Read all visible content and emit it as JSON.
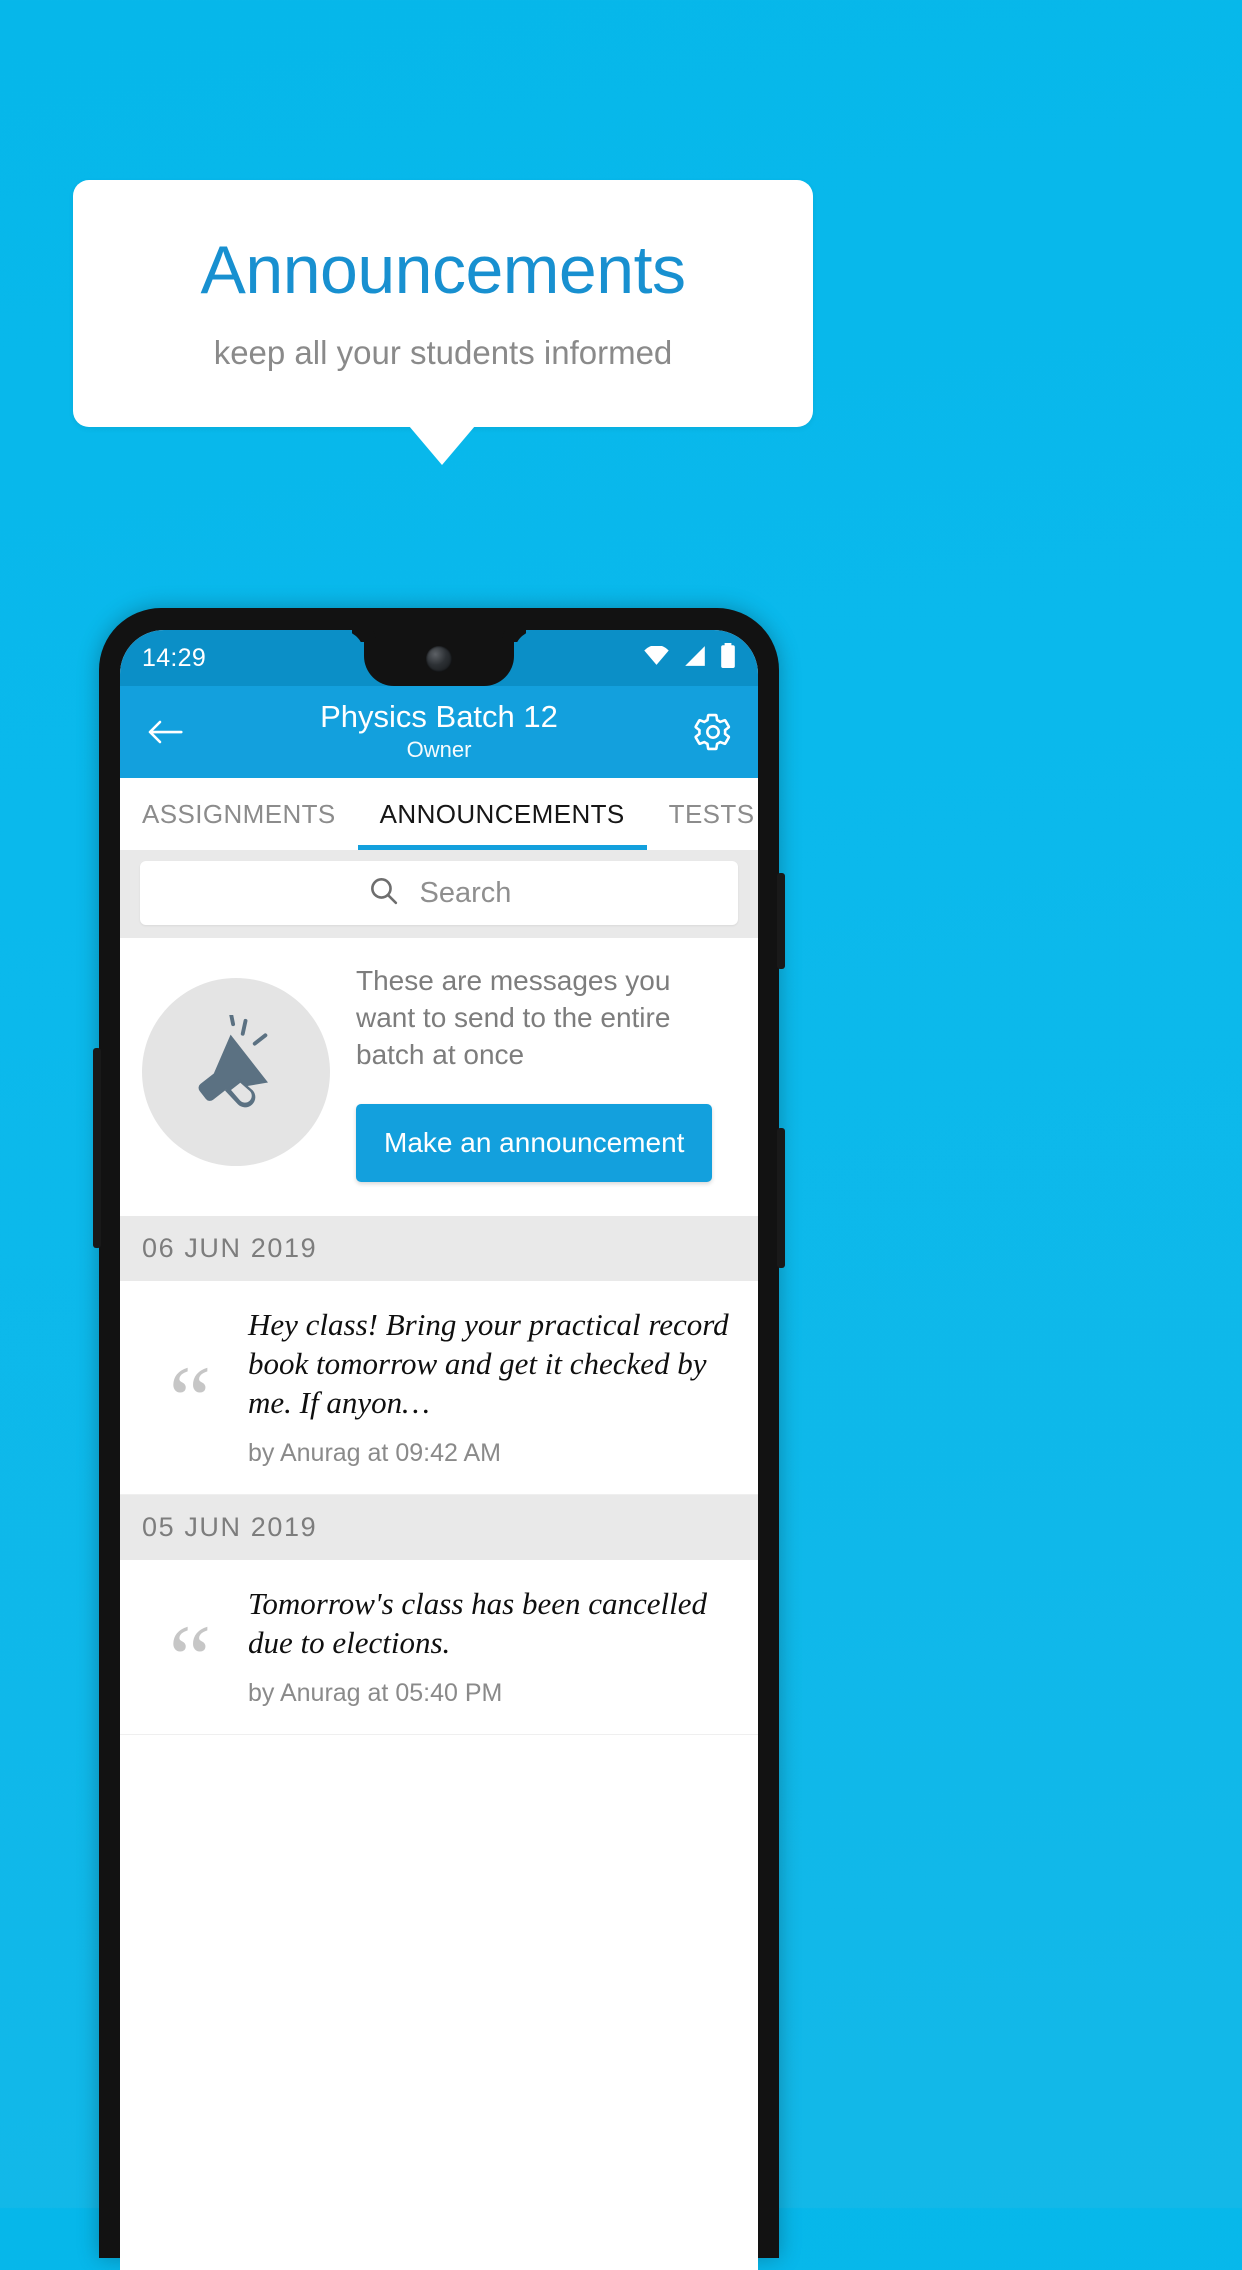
{
  "promo": {
    "title": "Announcements",
    "subtitle": "keep all your students informed",
    "title_color": "#1890d0",
    "background_color": "#0ab9ec"
  },
  "phone": {
    "statusbar": {
      "time": "14:29",
      "icons": [
        "wifi-icon",
        "signal-icon",
        "battery-icon"
      ]
    },
    "appbar": {
      "back_icon": "back-arrow-icon",
      "title": "Physics Batch 12",
      "subtitle": "Owner",
      "settings_icon": "gear-icon",
      "color": "#13a0dd"
    },
    "tabs": [
      {
        "label": "ASSIGNMENTS",
        "active": false
      },
      {
        "label": "ANNOUNCEMENTS",
        "active": true
      },
      {
        "label": "TESTS",
        "active": false
      },
      {
        "label": "’",
        "active": false
      }
    ],
    "search": {
      "placeholder": "Search",
      "icon": "search-icon"
    },
    "promo_card": {
      "icon": "megaphone-icon",
      "description": "These are messages you want to send to the entire batch at once",
      "button_label": "Make an announcement",
      "button_color": "#13a0dd"
    },
    "announcement_groups": [
      {
        "date": "06  JUN  2019",
        "items": [
          {
            "text": "Hey class! Bring your practical record book tomorrow and get it checked by me. If anyon…",
            "byline": "by Anurag at 09:42 AM"
          }
        ]
      },
      {
        "date": "05  JUN  2019",
        "items": [
          {
            "text": "Tomorrow's class has been cancelled due to elections.",
            "byline": "by Anurag at 05:40 PM"
          }
        ]
      }
    ]
  }
}
